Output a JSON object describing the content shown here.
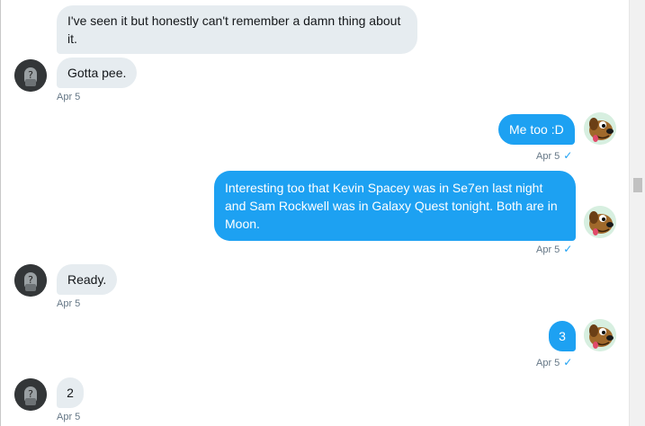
{
  "messages": [
    {
      "text": "I've seen it but honestly can't remember a damn thing about it.",
      "direction": "received"
    },
    {
      "text": "Gotta pee.",
      "direction": "received",
      "time": "Apr 5"
    },
    {
      "text": "Me too :D",
      "direction": "sent",
      "time": "Apr 5",
      "status_icon": "checkmark-icon"
    },
    {
      "text": "Interesting too that Kevin Spacey was in Se7en last night and Sam Rockwell was in Galaxy Quest tonight. Both are in Moon.",
      "direction": "sent",
      "time": "Apr 5",
      "status_icon": "checkmark-icon"
    },
    {
      "text": "Ready.",
      "direction": "received",
      "time": "Apr 5"
    },
    {
      "text": "3",
      "direction": "sent",
      "time": "Apr 5",
      "status_icon": "checkmark-icon"
    },
    {
      "text": "2",
      "direction": "received",
      "time": "Apr 5"
    }
  ],
  "check_glyph": "✓",
  "colors": {
    "sent_bubble": "#1da1f2",
    "received_bubble": "#e6ecf0",
    "timestamp": "#657786"
  }
}
